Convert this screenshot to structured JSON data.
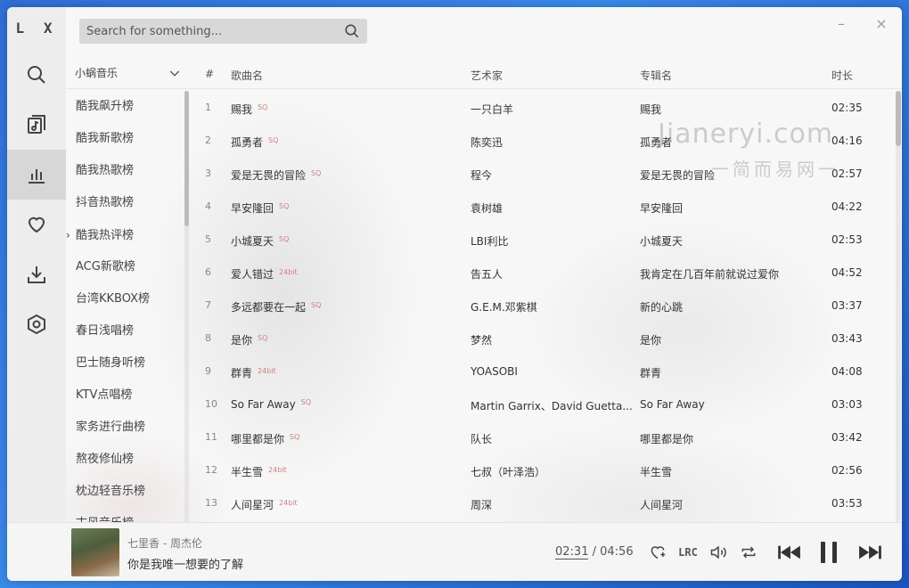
{
  "app": {
    "logo": "L X"
  },
  "search": {
    "placeholder": "Search for something..."
  },
  "window_controls": {
    "minimize": "–",
    "close": "×"
  },
  "rail": {
    "items": [
      {
        "icon": "search-icon"
      },
      {
        "icon": "song-list-icon"
      },
      {
        "icon": "leaderboard-icon",
        "active": true
      },
      {
        "icon": "heart-icon"
      },
      {
        "icon": "download-icon"
      },
      {
        "icon": "settings-icon"
      }
    ]
  },
  "board": {
    "source": "小蜗音乐",
    "items": [
      "酷我飙升榜",
      "酷我新歌榜",
      "酷我热歌榜",
      "抖音热歌榜",
      "酷我热评榜",
      "ACG新歌榜",
      "台湾KKBOX榜",
      "春日浅唱榜",
      "巴士随身听榜",
      "KTV点唱榜",
      "家务进行曲榜",
      "熬夜修仙榜",
      "枕边轻音乐榜",
      "古风音乐榜"
    ],
    "active_index": 4,
    "active_caret": "›"
  },
  "table": {
    "headers": {
      "num": "#",
      "name": "歌曲名",
      "artist": "艺术家",
      "album": "专辑名",
      "duration": "时长"
    },
    "rows": [
      {
        "num": "1",
        "name": "赐我",
        "quality": "SQ",
        "artist": "一只白羊",
        "album": "赐我",
        "duration": "02:35"
      },
      {
        "num": "2",
        "name": "孤勇者",
        "quality": "SQ",
        "artist": "陈奕迅",
        "album": "孤勇者",
        "duration": "04:16"
      },
      {
        "num": "3",
        "name": "爱是无畏的冒险",
        "quality": "SQ",
        "artist": "程今",
        "album": "爱是无畏的冒险",
        "duration": "02:57"
      },
      {
        "num": "4",
        "name": "早安隆回",
        "quality": "SQ",
        "artist": "袁树雄",
        "album": "早安隆回",
        "duration": "04:22"
      },
      {
        "num": "5",
        "name": "小城夏天",
        "quality": "SQ",
        "artist": "LBI利比",
        "album": "小城夏天",
        "duration": "02:53"
      },
      {
        "num": "6",
        "name": "爱人错过",
        "quality": "24bit",
        "artist": "告五人",
        "album": "我肯定在几百年前就说过爱你",
        "duration": "04:52"
      },
      {
        "num": "7",
        "name": "多远都要在一起",
        "quality": "SQ",
        "artist": "G.E.M.邓紫棋",
        "album": "新的心跳",
        "duration": "03:37"
      },
      {
        "num": "8",
        "name": "是你",
        "quality": "SQ",
        "artist": "梦然",
        "album": "是你",
        "duration": "03:43"
      },
      {
        "num": "9",
        "name": "群青",
        "quality": "24bit",
        "artist": "YOASOBI",
        "album": "群青",
        "duration": "04:08"
      },
      {
        "num": "10",
        "name": "So Far Away",
        "quality": "SQ",
        "artist": "Martin Garrix、David Guetta...",
        "album": "So Far Away",
        "duration": "03:03"
      },
      {
        "num": "11",
        "name": "哪里都是你",
        "quality": "SQ",
        "artist": "队长",
        "album": "哪里都是你",
        "duration": "03:42"
      },
      {
        "num": "12",
        "name": "半生雪",
        "quality": "24bit",
        "artist": "七叔（叶泽浩）",
        "album": "半生雪",
        "duration": "02:56"
      },
      {
        "num": "13",
        "name": "人间星河",
        "quality": "24bit",
        "artist": "周深",
        "album": "人间星河",
        "duration": "03:53"
      }
    ]
  },
  "watermark": {
    "main": "Jianeryi.com",
    "sub": "一简而易网一"
  },
  "player": {
    "title": "七里香 - 周杰伦",
    "lyric": "你是我唯一想要的了解",
    "current_time": "02:31",
    "separator": " / ",
    "total_time": "04:56",
    "lrc_label": "LRC"
  }
}
